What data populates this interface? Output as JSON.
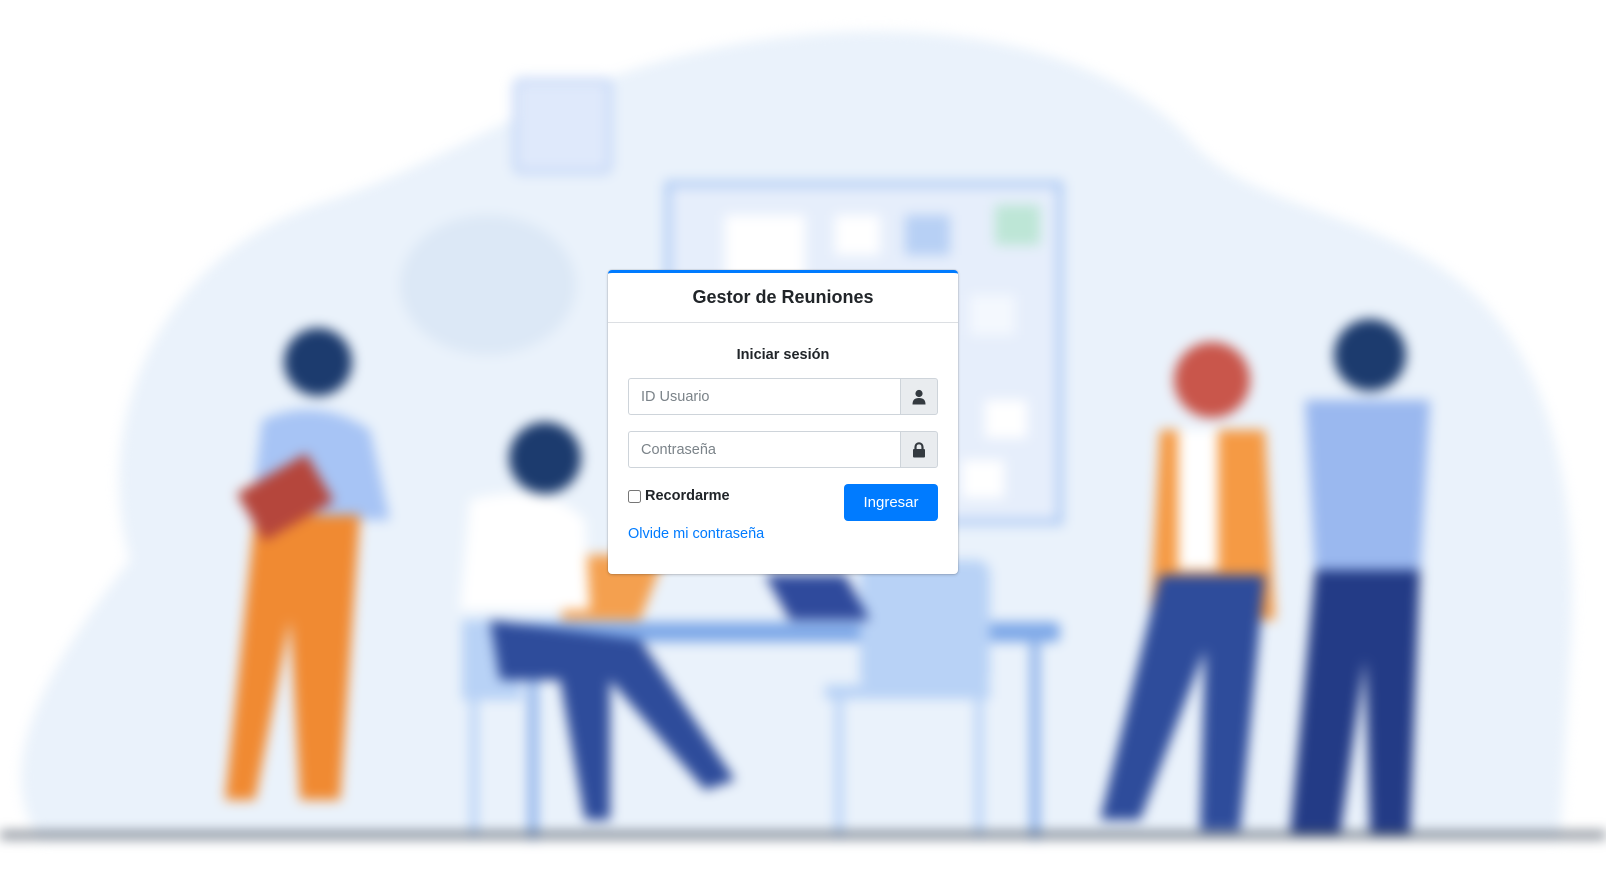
{
  "card": {
    "title": "Gestor de Reuniones",
    "subtitle": "Iniciar sesión"
  },
  "form": {
    "user_placeholder": "ID Usuario",
    "user_value": "",
    "user_icon": "user-icon",
    "password_placeholder": "Contraseña",
    "password_value": "",
    "password_icon": "lock-icon",
    "remember_label": "Recordarme",
    "remember_checked": false,
    "submit_label": "Ingresar",
    "forgot_label": "Olvide mi contraseña"
  },
  "colors": {
    "accent": "#007bff",
    "card_border_top": "#007bff",
    "background_blob": "#eaf2fb"
  }
}
